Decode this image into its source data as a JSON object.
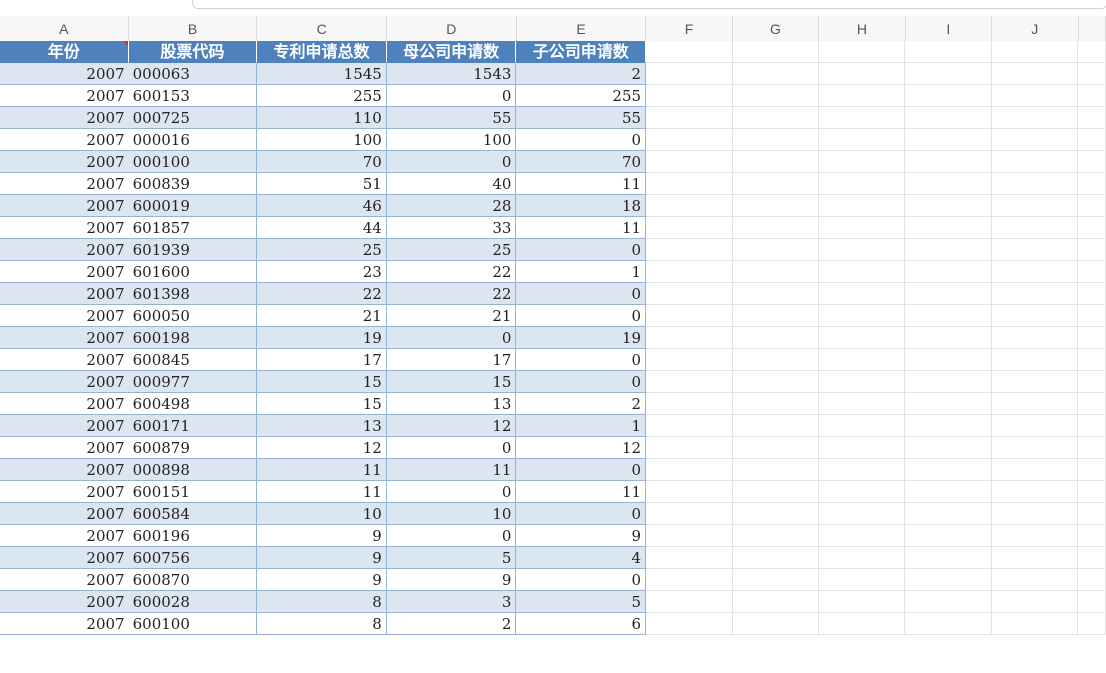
{
  "columns": [
    "A",
    "B",
    "C",
    "D",
    "E",
    "F",
    "G",
    "H",
    "I",
    "J"
  ],
  "table_header": {
    "year": "年份",
    "stock_code": "股票代码",
    "total_applications": "专利申请总数",
    "parent_applications": "母公司申请数",
    "subsidiary_applications": "子公司申请数"
  },
  "rows": [
    {
      "year": "2007",
      "code": "000063",
      "total": "1545",
      "parent": "1543",
      "sub": "2"
    },
    {
      "year": "2007",
      "code": "600153",
      "total": "255",
      "parent": "0",
      "sub": "255"
    },
    {
      "year": "2007",
      "code": "000725",
      "total": "110",
      "parent": "55",
      "sub": "55"
    },
    {
      "year": "2007",
      "code": "000016",
      "total": "100",
      "parent": "100",
      "sub": "0"
    },
    {
      "year": "2007",
      "code": "000100",
      "total": "70",
      "parent": "0",
      "sub": "70"
    },
    {
      "year": "2007",
      "code": "600839",
      "total": "51",
      "parent": "40",
      "sub": "11"
    },
    {
      "year": "2007",
      "code": "600019",
      "total": "46",
      "parent": "28",
      "sub": "18"
    },
    {
      "year": "2007",
      "code": "601857",
      "total": "44",
      "parent": "33",
      "sub": "11"
    },
    {
      "year": "2007",
      "code": "601939",
      "total": "25",
      "parent": "25",
      "sub": "0"
    },
    {
      "year": "2007",
      "code": "601600",
      "total": "23",
      "parent": "22",
      "sub": "1"
    },
    {
      "year": "2007",
      "code": "601398",
      "total": "22",
      "parent": "22",
      "sub": "0"
    },
    {
      "year": "2007",
      "code": "600050",
      "total": "21",
      "parent": "21",
      "sub": "0"
    },
    {
      "year": "2007",
      "code": "600198",
      "total": "19",
      "parent": "0",
      "sub": "19"
    },
    {
      "year": "2007",
      "code": "600845",
      "total": "17",
      "parent": "17",
      "sub": "0"
    },
    {
      "year": "2007",
      "code": "000977",
      "total": "15",
      "parent": "15",
      "sub": "0"
    },
    {
      "year": "2007",
      "code": "600498",
      "total": "15",
      "parent": "13",
      "sub": "2"
    },
    {
      "year": "2007",
      "code": "600171",
      "total": "13",
      "parent": "12",
      "sub": "1"
    },
    {
      "year": "2007",
      "code": "600879",
      "total": "12",
      "parent": "0",
      "sub": "12"
    },
    {
      "year": "2007",
      "code": "000898",
      "total": "11",
      "parent": "11",
      "sub": "0"
    },
    {
      "year": "2007",
      "code": "600151",
      "total": "11",
      "parent": "0",
      "sub": "11"
    },
    {
      "year": "2007",
      "code": "600584",
      "total": "10",
      "parent": "10",
      "sub": "0"
    },
    {
      "year": "2007",
      "code": "600196",
      "total": "9",
      "parent": "0",
      "sub": "9"
    },
    {
      "year": "2007",
      "code": "600756",
      "total": "9",
      "parent": "5",
      "sub": "4"
    },
    {
      "year": "2007",
      "code": "600870",
      "total": "9",
      "parent": "9",
      "sub": "0"
    },
    {
      "year": "2007",
      "code": "600028",
      "total": "8",
      "parent": "3",
      "sub": "5"
    },
    {
      "year": "2007",
      "code": "600100",
      "total": "8",
      "parent": "2",
      "sub": "6"
    }
  ],
  "colors": {
    "header_bg": "#4f81bd",
    "band_blue": "#dce6f1",
    "band_white": "#ffffff",
    "border": "#95b3d7"
  }
}
